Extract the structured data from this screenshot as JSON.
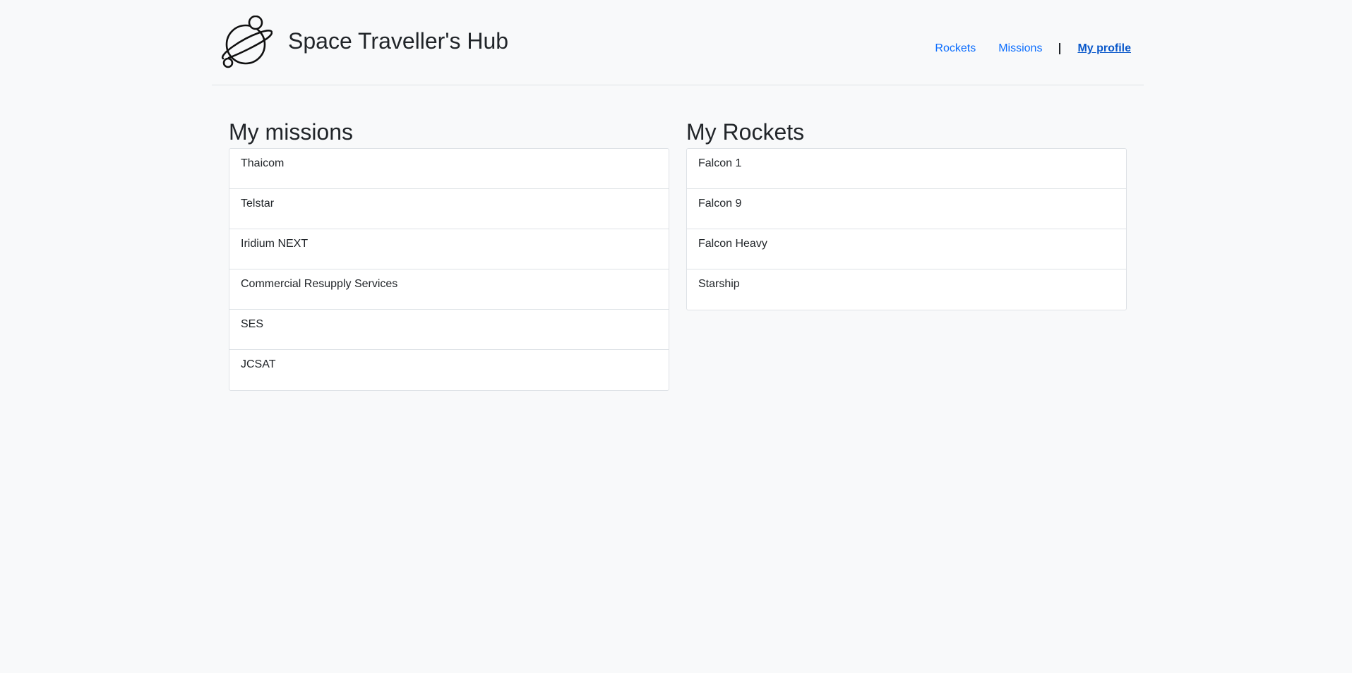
{
  "header": {
    "logo_icon": "planet-icon",
    "title": "Space Traveller's Hub"
  },
  "nav": {
    "items": [
      {
        "label": "Rockets",
        "active": false
      },
      {
        "label": "Missions",
        "active": false
      },
      {
        "label": "My profile",
        "active": true
      }
    ]
  },
  "missions": {
    "heading": "My missions",
    "items": [
      "Thaicom",
      "Telstar",
      "Iridium NEXT",
      "Commercial Resupply Services",
      "SES",
      "JCSAT"
    ]
  },
  "rockets": {
    "heading": "My Rockets",
    "items": [
      "Falcon 1",
      "Falcon 9",
      "Falcon Heavy",
      "Starship"
    ]
  },
  "colors": {
    "background": "#f8f9fa",
    "link": "#0d6efd",
    "active_link": "#0a58ca",
    "border": "#dee2e6"
  }
}
